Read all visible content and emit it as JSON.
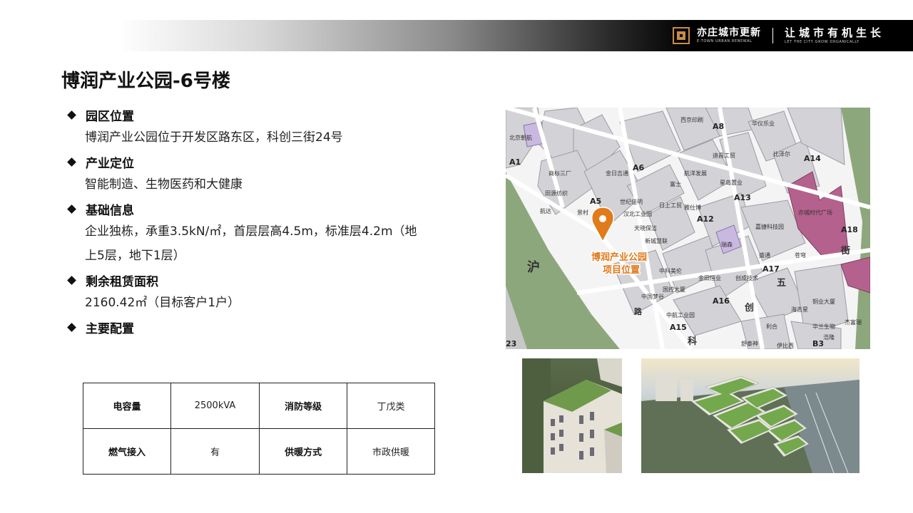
{
  "header": {
    "brand_cn": "亦庄城市更新",
    "brand_en": "E-TOWN URBAN RENEWAL",
    "slogan_cn": "让城市有机生长",
    "slogan_en": "LET THE CITY GROW ORGANICALLY"
  },
  "title": "博润产业公园-6号楼",
  "sections": [
    {
      "heading": "园区位置",
      "lines": [
        "博润产业公园位于开发区路东区，科创三街24号"
      ]
    },
    {
      "heading": "产业定位",
      "lines": [
        "智能制造、生物医药和大健康"
      ]
    },
    {
      "heading": "基础信息",
      "lines": [
        "企业独栋，承重3.5kN/㎡，首层层高4.5m，标准层4.2m（地",
        "上5层，地下1层）"
      ]
    },
    {
      "heading": "剩余租赁面积",
      "lines": [
        "2160.42㎡（目标客户1户）"
      ]
    },
    {
      "heading": "主要配置",
      "lines": []
    }
  ],
  "config_table": {
    "rows": [
      [
        "电容量",
        "2500kVA",
        "消防等级",
        "丁戊类"
      ],
      [
        "燃气接入",
        "有",
        "供暖方式",
        "市政供暖"
      ]
    ]
  },
  "map": {
    "marker_label_1": "博润产业公园",
    "marker_label_2": "项目位置",
    "block_codes": [
      "A1",
      "A5",
      "A6",
      "A8",
      "A12",
      "A13",
      "A14",
      "A15",
      "A16",
      "A17",
      "A18",
      "23",
      "B3"
    ],
    "place_names": [
      "北京朝航",
      "商标三厂",
      "田源纺织",
      "航达",
      "景村",
      "金日吉通",
      "世纪佳明",
      "汉北工业园",
      "日上工贸",
      "天晓保洁",
      "新城慧联",
      "雅仕博",
      "富士",
      "航洋发展",
      "迪昌工贸",
      "星岛置业",
      "西京印刷",
      "华仪乐业",
      "比泽尔",
      "亦城时代广场",
      "嘉捷科技园",
      "盛通",
      "苍穹",
      "金田恒业",
      "创成技术",
      "中科美伦",
      "国控大厦",
      "中国梦谷",
      "中航工业园",
      "海吉星",
      "华兰生物",
      "杰富瑞",
      "利合",
      "舒泰神",
      "伊比西",
      "浩隆",
      "瑞森",
      "铜业大厦"
    ],
    "road_labels": [
      "沪",
      "五",
      "街",
      "创",
      "科",
      "路"
    ]
  },
  "colors": {
    "accent_orange": "#e07a1a",
    "map_green": "#8da77c",
    "map_block": "#d3d3d7",
    "map_purple": "#b5618e",
    "map_lilac": "#c9b8e0"
  }
}
